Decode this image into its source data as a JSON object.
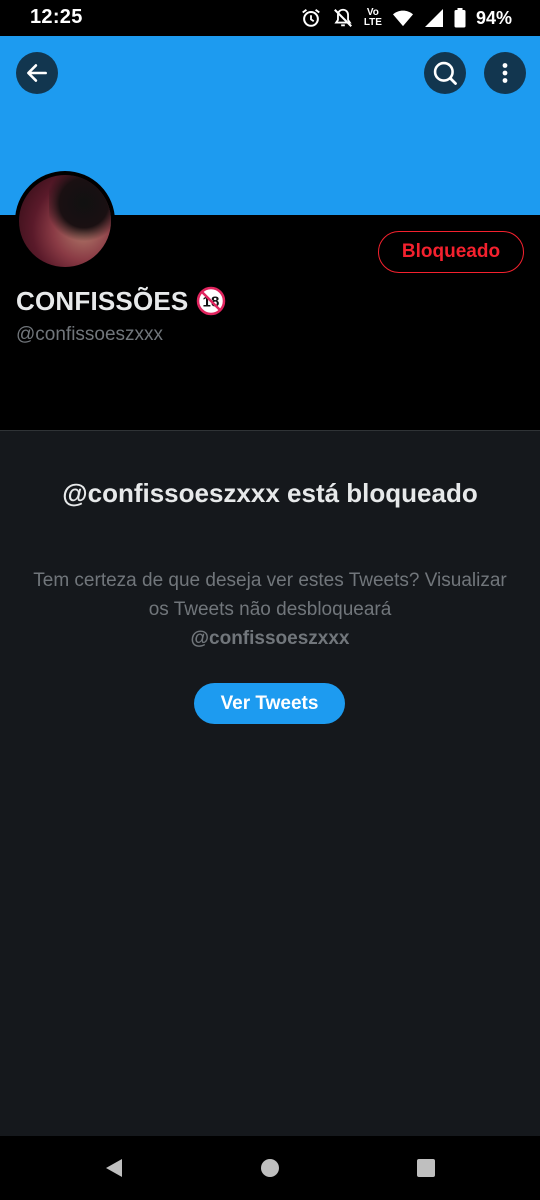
{
  "status_bar": {
    "time": "12:25",
    "volte_label_top": "Vo",
    "volte_label_bottom": "LTE",
    "battery": "94%"
  },
  "header": {
    "back_icon": "arrow-left-icon",
    "search_icon": "search-icon",
    "more_icon": "more-vertical-icon",
    "banner_color": "#1d9bf0"
  },
  "profile": {
    "display_name": "CONFISSÕES",
    "adult_badge": "18",
    "handle": "@confissoeszxxx",
    "blocked_button_label": "Bloqueado",
    "blocked_color": "#f4212e"
  },
  "blocked_notice": {
    "title": "@confissoeszxxx está bloqueado",
    "description": "Tem certeza de que deseja ver estes Tweets? Visualizar os Tweets não desbloqueará",
    "handle": "@confissoeszxxx",
    "view_button_label": "Ver Tweets"
  },
  "nav_bar": {
    "back_icon": "triangle-back-icon",
    "home_icon": "circle-home-icon",
    "recents_icon": "square-recents-icon"
  }
}
